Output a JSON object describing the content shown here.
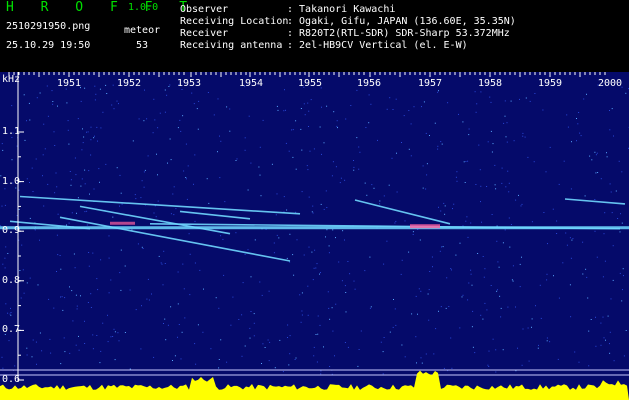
{
  "header": {
    "app_title": "H R O F F T",
    "version": "1.0.0",
    "file_name": "2510291950.png",
    "meteor_label": "meteor",
    "datetime": "25.10.29 19:50",
    "meteor_count": "53",
    "info": [
      {
        "key": "Observer",
        "value": ": Takanori Kawachi"
      },
      {
        "key": "Receiving Location",
        "value": ": Ogaki, Gifu, JAPAN (136.60E, 35.35N)"
      },
      {
        "key": "Receiver",
        "value": ": R820T2(RTL-SDR) SDR-Sharp 53.372MHz"
      },
      {
        "key": "Receiving antenna",
        "value": ": 2el-HB9CV Vertical (el. E-W)"
      }
    ]
  },
  "spectrogram": {
    "y_unit": "kHz",
    "x_ticks": [
      "1951",
      "1952",
      "1953",
      "1954",
      "1955",
      "1956",
      "1957",
      "1958",
      "1959",
      "2000"
    ],
    "y_ticks": [
      "1.1",
      "1.0",
      "0.9",
      "0.8",
      "0.7",
      "0.6"
    ],
    "colors": {
      "background": "#050a6a",
      "signal": "#70d8ff",
      "hot": "#ff60a0",
      "level": "#ffff00",
      "label_green": "#00e000"
    }
  }
}
